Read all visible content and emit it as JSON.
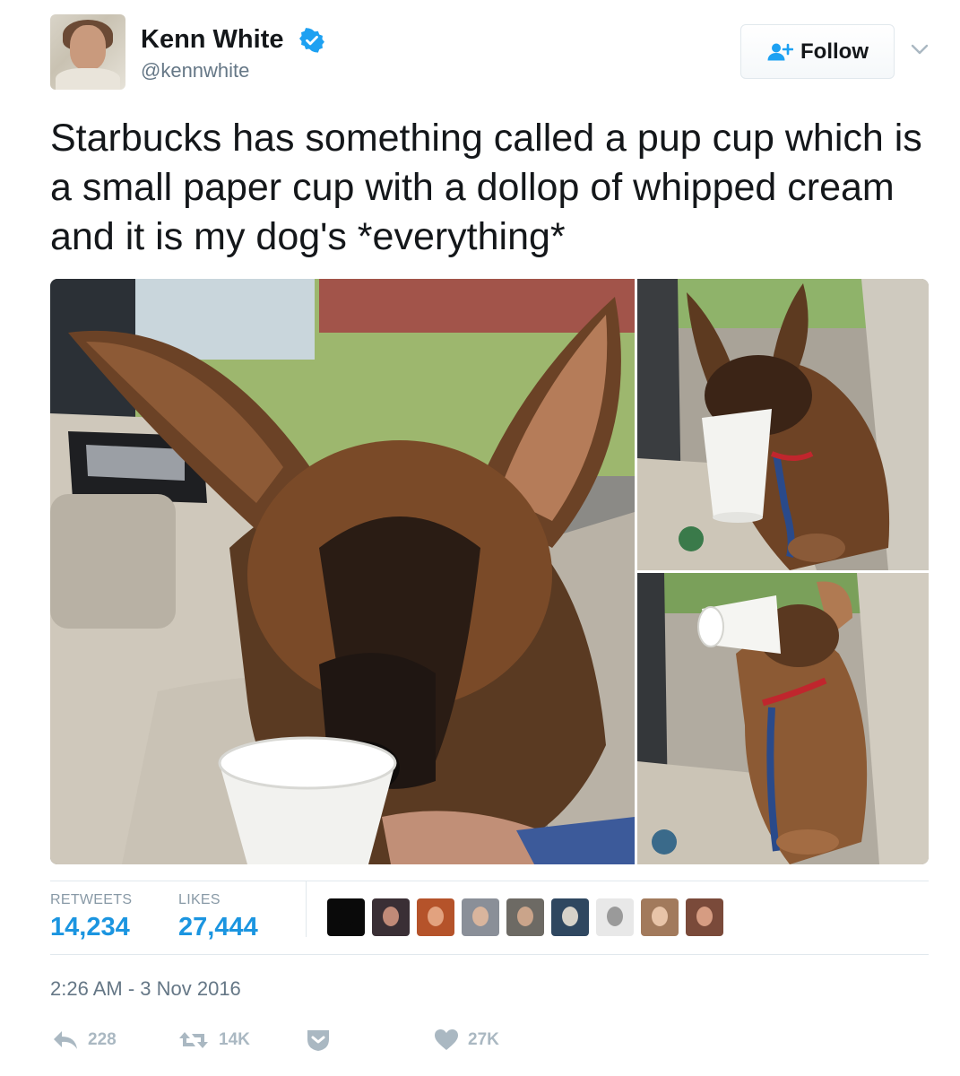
{
  "author": {
    "display_name": "Kenn White",
    "handle": "@kennwhite",
    "verified": true,
    "avatar_icon": "avatar-photo"
  },
  "follow_button": {
    "label": "Follow",
    "icon": "follow-user-plus-icon"
  },
  "more_menu_icon": "chevron-down-icon",
  "tweet": {
    "text": "Starbucks has something called a pup cup which is a small paper cup with a dollop of whipped cream and it is my dog's *everything*"
  },
  "media": {
    "photos": [
      {
        "icon": "photo-puppy-licking-cup"
      },
      {
        "icon": "photo-puppy-cup-on-nose"
      },
      {
        "icon": "photo-puppy-cup-over-face"
      }
    ]
  },
  "stats": {
    "retweets_label": "RETWEETS",
    "retweets_value": "14,234",
    "likes_label": "LIKES",
    "likes_value": "27,444"
  },
  "likers": [
    {
      "bg": "#0a0a0a",
      "face": "#0a0a0a"
    },
    {
      "bg": "#3a2f35",
      "face": "#c08a78"
    },
    {
      "bg": "#b5532a",
      "face": "#e2a27f"
    },
    {
      "bg": "#8a8f98",
      "face": "#d9b59d"
    },
    {
      "bg": "#6d6a64",
      "face": "#caa48a"
    },
    {
      "bg": "#2f4760",
      "face": "#d7d2c9"
    },
    {
      "bg": "#e8e8e8",
      "face": "#9a9a9a"
    },
    {
      "bg": "#a27a5c",
      "face": "#e8c4a8"
    },
    {
      "bg": "#7a4a3a",
      "face": "#d69c82"
    }
  ],
  "timestamp": "2:26 AM - 3 Nov 2016",
  "actions": {
    "reply_count": "228",
    "retweet_count": "14K",
    "like_count": "27K"
  },
  "colors": {
    "accent": "#1b95e0",
    "muted": "#8899a6",
    "action_icon": "#aab8c2",
    "divider": "#e1e8ed"
  }
}
